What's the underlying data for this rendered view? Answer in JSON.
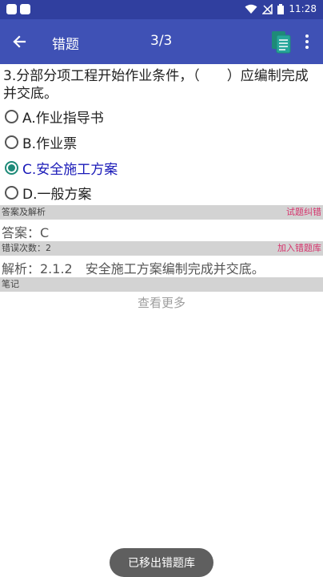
{
  "status_bar": {
    "time": "11:28"
  },
  "toolbar": {
    "title": "错题",
    "counter": "3/3"
  },
  "question": {
    "text": "3.分部分项工程开始作业条件，（　　）应编制完成并交底。"
  },
  "options": [
    {
      "label": "A.作业指导书",
      "selected": false
    },
    {
      "label": "B.作业票",
      "selected": false
    },
    {
      "label": "C.安全施工方案",
      "selected": true
    },
    {
      "label": "D.一般方案",
      "selected": false
    }
  ],
  "analysis_section": {
    "title": "答案及解析",
    "action": "试题纠错"
  },
  "answer": {
    "text": "答案：C"
  },
  "error_section": {
    "title": "错误次数：2",
    "action": "加入错题库"
  },
  "explanation": {
    "text": "解析：2.1.2　安全施工方案编制完成并交底。"
  },
  "notes_section": {
    "title": "笔记"
  },
  "more": {
    "label": "查看更多"
  },
  "toast": {
    "text": "已移出错题库"
  },
  "colors": {
    "status_bar": "#303f9f",
    "toolbar": "#3f51b5",
    "selected_text": "#1a1ab8",
    "radio_selected": "#1e8a78",
    "link": "#d6336c"
  }
}
